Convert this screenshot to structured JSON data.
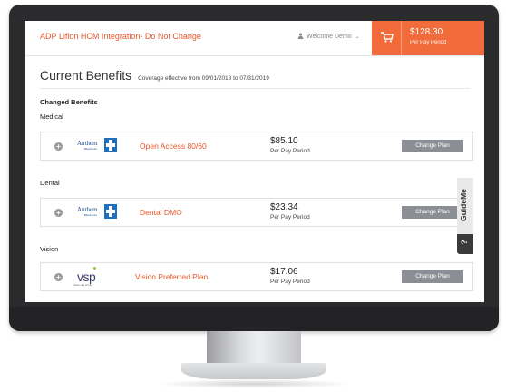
{
  "header": {
    "app_title": "ADP Lifion HCM Integration- Do Not Change",
    "welcome": "Welcome Demo",
    "cart": {
      "amount": "$128.30",
      "period": "Per Pay Period"
    }
  },
  "page": {
    "title": "Current Benefits",
    "coverage": "Coverage effective from 09/01/2018 to 07/31/2019",
    "section_heading": "Changed Benefits"
  },
  "plans": [
    {
      "category": "Medical",
      "logo": "Anthem",
      "logo_sub": "BlueCross",
      "name": "Open Access 80/60",
      "price": "$85.10",
      "period": "Per Pay Period",
      "button": "Change Plan"
    },
    {
      "category": "Dental",
      "logo": "Anthem",
      "logo_sub": "BlueCross",
      "name": "Dental DMO",
      "price": "$23.34",
      "period": "Per Pay Period",
      "button": "Change Plan"
    },
    {
      "category": "Vision",
      "logo": "vsp",
      "logo_sub": "Vision care for life",
      "name": "Vision Preferred Plan",
      "price": "$17.06",
      "period": "Per Pay Period",
      "button": "Change Plan"
    }
  ],
  "guide": {
    "label": "GuideMe",
    "help": "?"
  },
  "colors": {
    "accent": "#f26b3a",
    "link": "#e8572a",
    "button": "#8b8e94",
    "bezel": "#2b2b2d"
  },
  "icons": [
    "person-icon",
    "cart-icon",
    "plus-icon",
    "anthem-logo",
    "vsp-logo",
    "question-icon"
  ]
}
